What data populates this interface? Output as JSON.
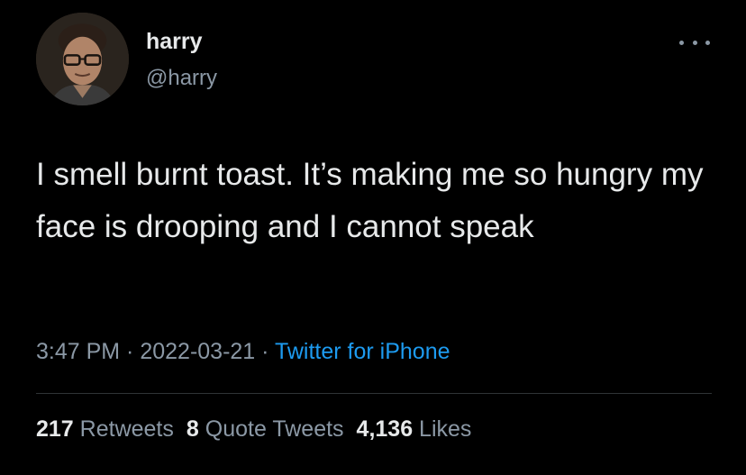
{
  "tweet": {
    "author_name": "harry",
    "author_handle": "@harry",
    "text": "I smell burnt toast. It’s making me so hungry my face is drooping and I cannot speak",
    "time": "3:47 PM",
    "separator": " · ",
    "date": "2022-03-21",
    "source": "Twitter for iPhone",
    "stats": {
      "retweets_count": "217",
      "retweets_label": " Retweets",
      "quotes_count": "8",
      "quotes_label": " Quote Tweets",
      "likes_count": "4,136",
      "likes_label": " Likes"
    }
  },
  "icons": {
    "more": "more-horizontal-icon",
    "avatar": "user-avatar"
  },
  "colors": {
    "background": "#000000",
    "primary_text": "#e7e9ea",
    "secondary_text": "#8b98a5",
    "link": "#1d9bf0",
    "divider": "#2f3336"
  }
}
